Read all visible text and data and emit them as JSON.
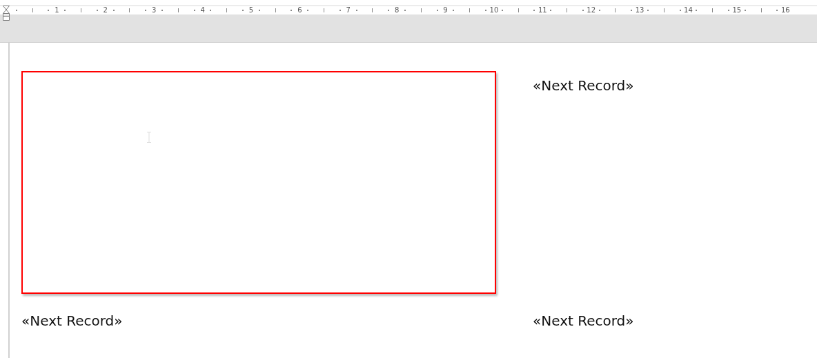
{
  "ruler": {
    "numbers": [
      "1",
      "2",
      "3",
      "4",
      "5",
      "6",
      "7",
      "8",
      "9",
      "10",
      "11",
      "12",
      "13",
      "14",
      "15",
      "16"
    ]
  },
  "cells": [
    {
      "kind": "frame"
    },
    {
      "kind": "field",
      "text": "«Next Record»"
    },
    {
      "kind": "field",
      "text": "«Next Record»"
    },
    {
      "kind": "field",
      "text": "«Next Record»"
    }
  ]
}
